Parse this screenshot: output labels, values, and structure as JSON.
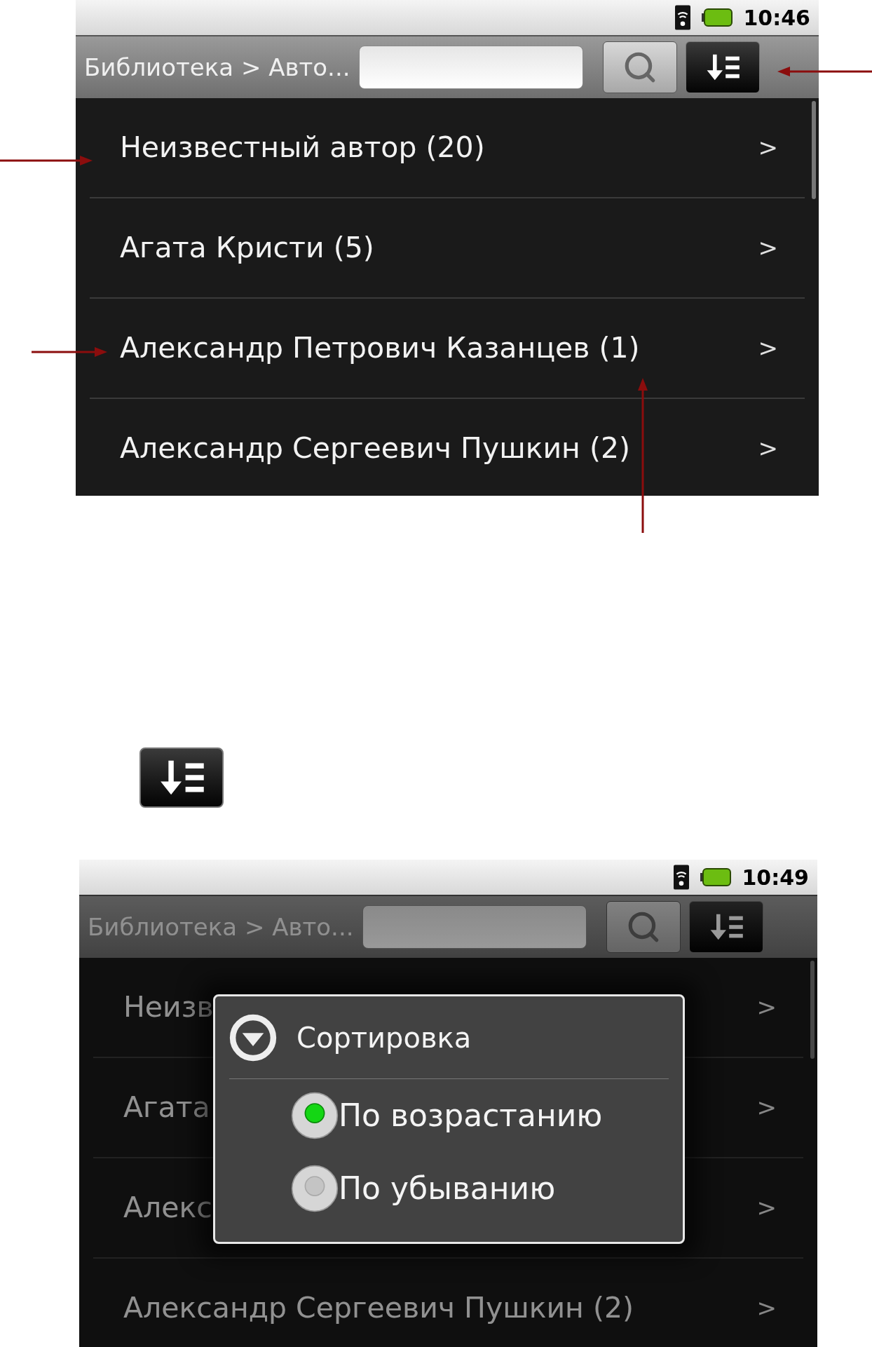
{
  "screens": [
    {
      "status_bar": {
        "time": "10:46"
      },
      "title_bar": {
        "breadcrumb": "Библиотека > Авто..."
      },
      "dimmed": false,
      "list": [
        {
          "label": "Неизвестный автор (20)",
          "chevron": ">"
        },
        {
          "label": "Агата Кристи (5)",
          "chevron": ">"
        },
        {
          "label": "Александр Петрович Казанцев (1)",
          "chevron": ">"
        },
        {
          "label": "Александр Сергеевич Пушкин (2)",
          "chevron": ">"
        }
      ]
    },
    {
      "status_bar": {
        "time": "10:49"
      },
      "title_bar": {
        "breadcrumb": "Библиотека > Авто..."
      },
      "dimmed": true,
      "list": [
        {
          "label": "Неизв",
          "chevron": ">"
        },
        {
          "label": "Агата",
          "chevron": ">"
        },
        {
          "label": "Алекс",
          "chevron": ">"
        },
        {
          "label": "Александр Сергеевич Пушкин (2)",
          "chevron": ">"
        }
      ],
      "dialog": {
        "title": "Сортировка",
        "options": [
          {
            "label": "По возрастанию",
            "selected": true
          },
          {
            "label": "По убыванию",
            "selected": false
          }
        ]
      }
    }
  ]
}
